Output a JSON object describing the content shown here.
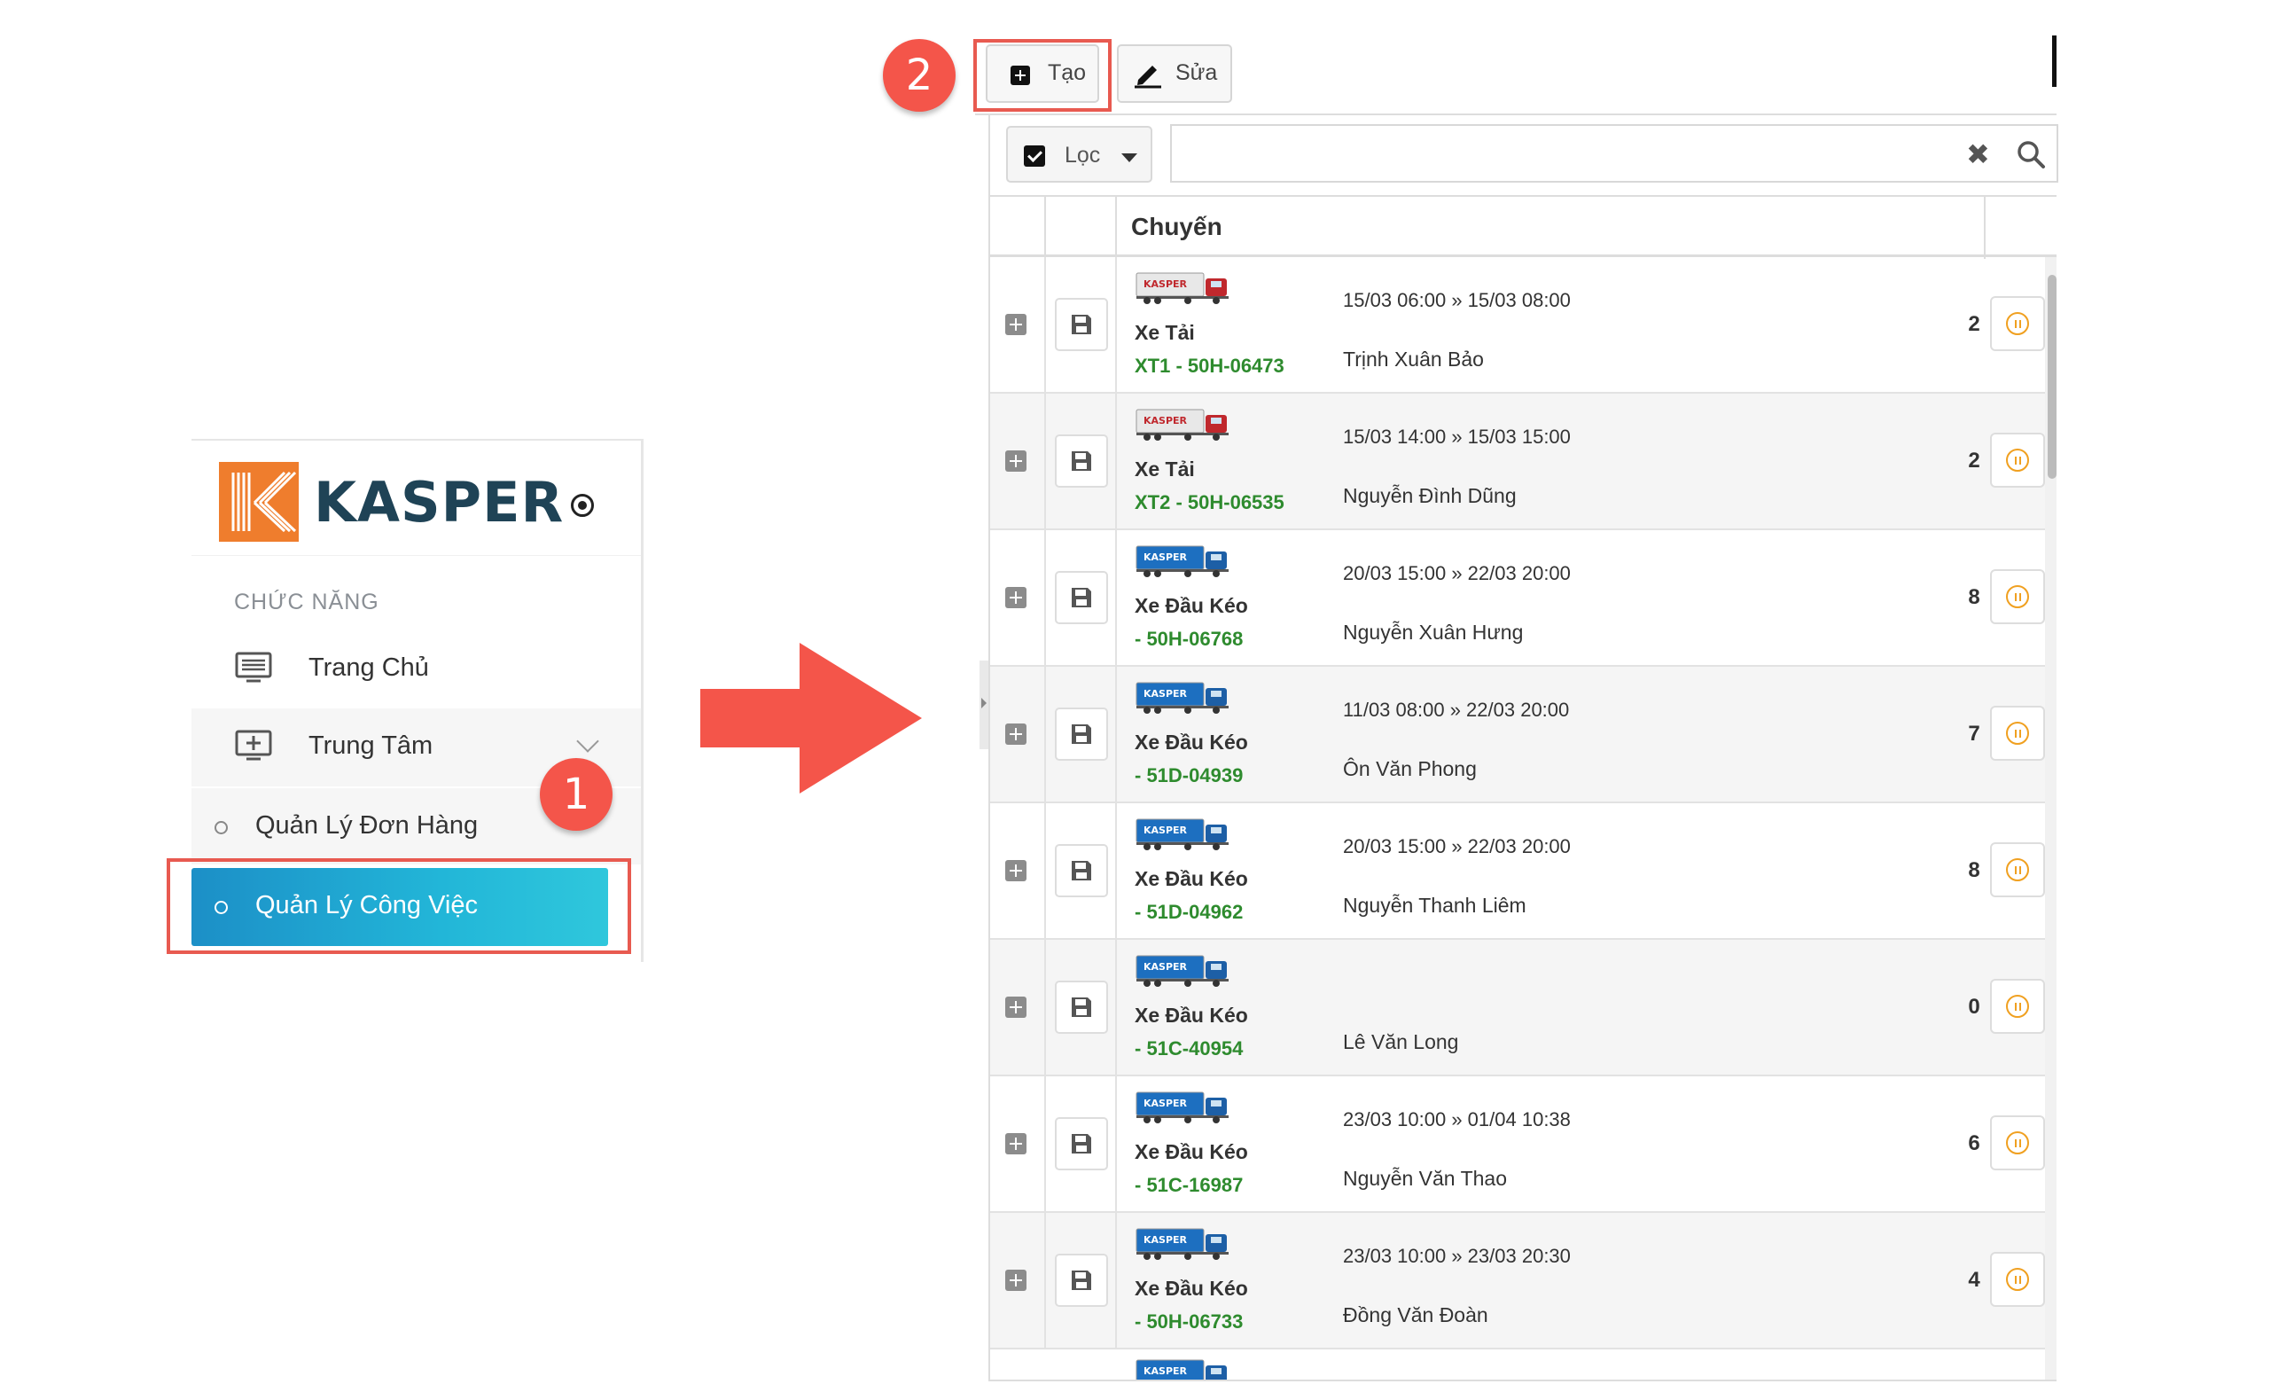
{
  "sidebar": {
    "logo_text": "KASPER",
    "section_title": "CHỨC NĂNG",
    "menu": {
      "home": "Trang Chủ",
      "center": "Trung Tâm",
      "orders": "Quản Lý Đơn Hàng",
      "tasks": "Quản Lý Công Việc"
    },
    "active_color": "#22b6d8"
  },
  "badges": {
    "step1": "1",
    "step2": "2",
    "color": "#f4554a"
  },
  "toolbar": {
    "create_label": "Tạo",
    "edit_label": "Sửa"
  },
  "filter": {
    "label": "Lọc",
    "search_value": "",
    "clear_symbol": "✖"
  },
  "grid": {
    "header": "Chuyến",
    "rows": [
      {
        "truck": "red",
        "type": "Xe Tải",
        "plate": "XT1 - 50H-06473",
        "time": "15/03 06:00 » 15/03 08:00",
        "driver": "Trịnh Xuân Bảo",
        "count": "2"
      },
      {
        "truck": "red",
        "type": "Xe Tải",
        "plate": "XT2 - 50H-06535",
        "time": "15/03 14:00 » 15/03 15:00",
        "driver": "Nguyễn Đình Dũng",
        "count": "2"
      },
      {
        "truck": "blue",
        "type": "Xe Đầu Kéo",
        "plate": "- 50H-06768",
        "time": "20/03 15:00 » 22/03 20:00",
        "driver": "Nguyễn Xuân Hưng",
        "count": "8"
      },
      {
        "truck": "blue",
        "type": "Xe Đầu Kéo",
        "plate": "- 51D-04939",
        "time": "11/03 08:00 » 22/03 20:00",
        "driver": "Ôn Văn Phong",
        "count": "7"
      },
      {
        "truck": "blue",
        "type": "Xe Đầu Kéo",
        "plate": "- 51D-04962",
        "time": "20/03 15:00 » 22/03 20:00",
        "driver": "Nguyễn Thanh Liêm",
        "count": "8"
      },
      {
        "truck": "blue",
        "type": "Xe Đầu Kéo",
        "plate": "- 51C-40954",
        "time": "",
        "driver": "Lê Văn Long",
        "count": "0"
      },
      {
        "truck": "blue",
        "type": "Xe Đầu Kéo",
        "plate": "- 51C-16987",
        "time": "23/03 10:00 » 01/04 10:38",
        "driver": "Nguyễn Văn Thao",
        "count": "6"
      },
      {
        "truck": "blue",
        "type": "Xe Đầu Kéo",
        "plate": "- 50H-06733",
        "time": "23/03 10:00 » 23/03 20:30",
        "driver": "Đồng Văn Đoàn",
        "count": "4"
      }
    ],
    "truck_brand": "KASPER",
    "plate_color": "#2e8b2e",
    "pause_color": "#f0a020"
  }
}
